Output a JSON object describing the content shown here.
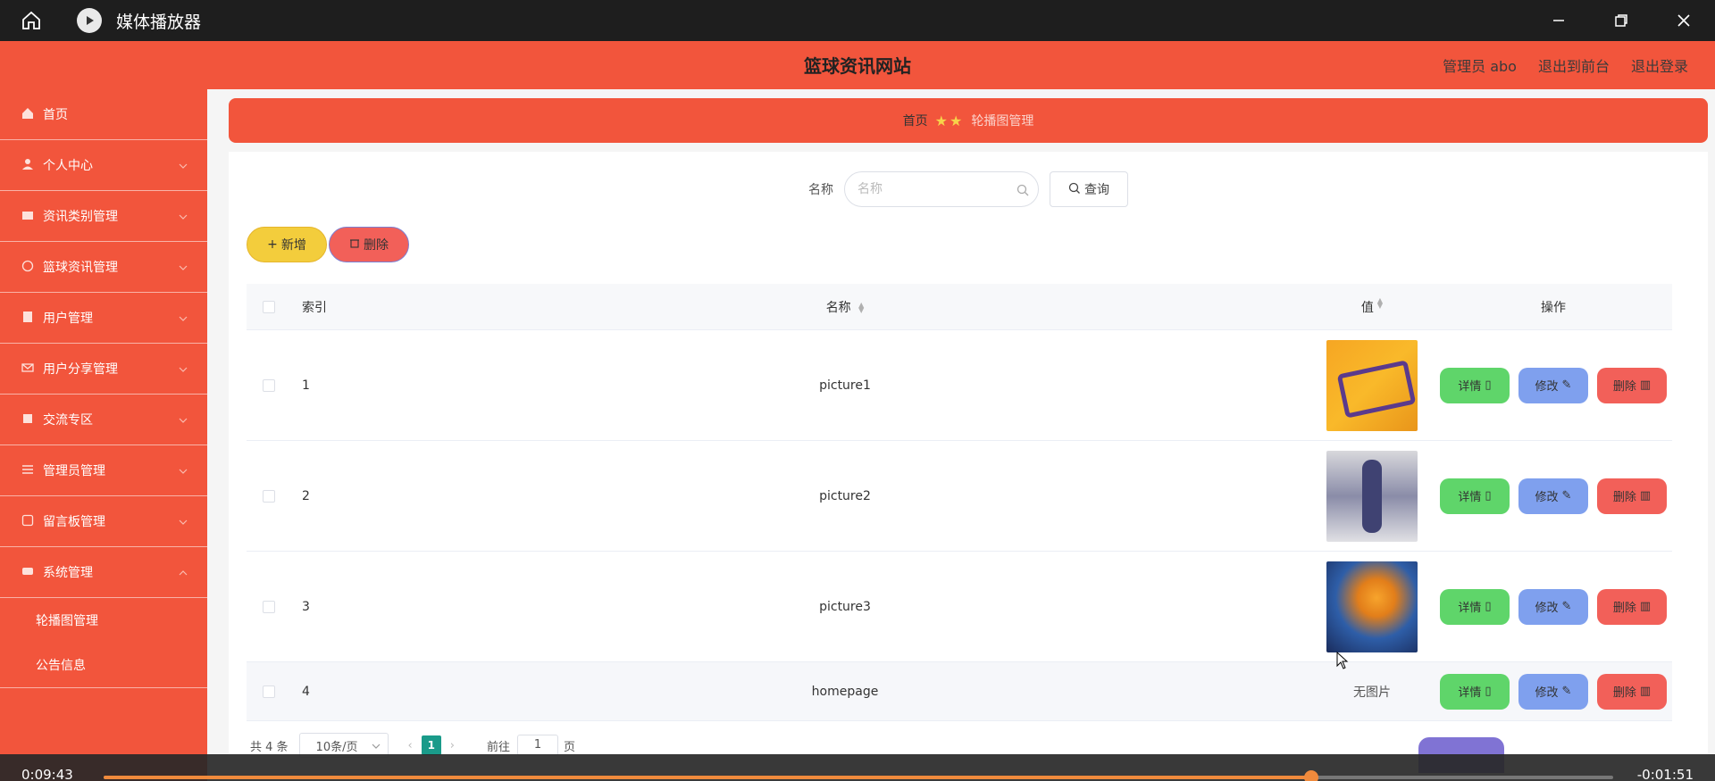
{
  "player": {
    "title": "媒体播放器",
    "time_current": "0:09:43",
    "time_remaining": "-0:01:51",
    "progress_fraction": 0.8
  },
  "header": {
    "site_title": "篮球资讯网站",
    "admin_label": "管理员 abo",
    "front_link": "退出到前台",
    "logout_link": "退出登录"
  },
  "sidebar": {
    "items": [
      {
        "label": "首页",
        "icon": "home-icon"
      },
      {
        "label": "个人中心",
        "icon": "user-icon"
      },
      {
        "label": "资讯类别管理",
        "icon": "folder-icon"
      },
      {
        "label": "篮球资讯管理",
        "icon": "basketball-icon"
      },
      {
        "label": "用户管理",
        "icon": "users-icon"
      },
      {
        "label": "用户分享管理",
        "icon": "mail-icon"
      },
      {
        "label": "交流专区",
        "icon": "chat-icon"
      },
      {
        "label": "管理员管理",
        "icon": "list-icon"
      },
      {
        "label": "留言板管理",
        "icon": "message-icon"
      },
      {
        "label": "系统管理",
        "icon": "settings-icon"
      }
    ],
    "sub_items": [
      "轮播图管理",
      "公告信息"
    ]
  },
  "breadcrumb": {
    "home": "首页",
    "current": "轮播图管理"
  },
  "search": {
    "label": "名称",
    "placeholder": "名称",
    "button": "查询"
  },
  "actions": {
    "add": "新增",
    "delete": "删除"
  },
  "table": {
    "headers": {
      "index": "索引",
      "name": "名称",
      "value": "值",
      "ops": "操作"
    },
    "rows": [
      {
        "index": "1",
        "name": "picture1",
        "value": "image"
      },
      {
        "index": "2",
        "name": "picture2",
        "value": "image"
      },
      {
        "index": "3",
        "name": "picture3",
        "value": "image"
      },
      {
        "index": "4",
        "name": "homepage",
        "value": "无图片"
      }
    ],
    "ops": {
      "detail": "详情",
      "edit": "修改",
      "delete": "删除"
    }
  },
  "pager": {
    "total": "共 4 条",
    "page_size": "10条/页",
    "current_page": "1",
    "goto_label": "前往",
    "goto_value": "1",
    "goto_suffix": "页"
  }
}
